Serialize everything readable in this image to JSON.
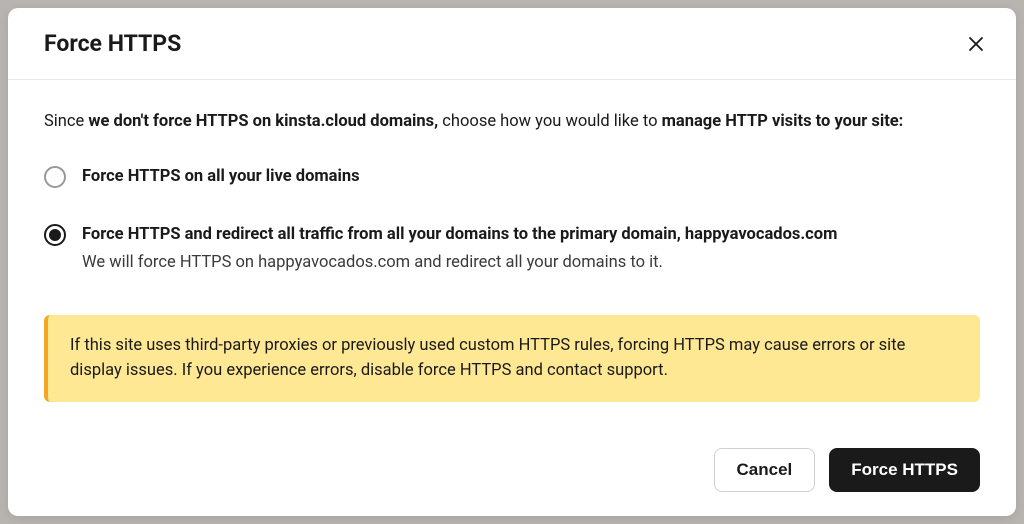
{
  "modal": {
    "title": "Force HTTPS",
    "intro": {
      "prefix": "Since ",
      "bold1": "we don't force HTTPS on kinsta.cloud domains,",
      "mid": " choose how you would like to ",
      "bold2": "manage HTTP visits to your site:"
    },
    "options": [
      {
        "label": "Force HTTPS on all your live domains",
        "description": "",
        "selected": false
      },
      {
        "label": "Force HTTPS and redirect all traffic from all your domains to the primary domain, happyavocados.com",
        "description": "We will force HTTPS on happyavocados.com and redirect all your domains to it.",
        "selected": true
      }
    ],
    "warning": "If this site uses third-party proxies or previously used custom HTTPS rules, forcing HTTPS may cause errors or site display issues. If you experience errors, disable force HTTPS and contact support.",
    "buttons": {
      "cancel": "Cancel",
      "confirm": "Force HTTPS"
    }
  }
}
